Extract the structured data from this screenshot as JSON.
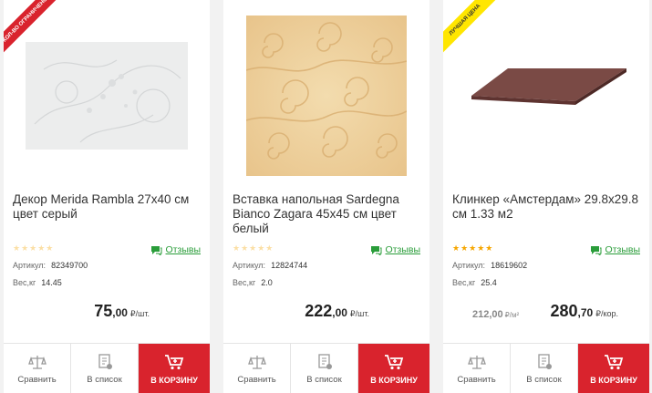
{
  "products": [
    {
      "ribbon": "КОЛ-ВО ОГРАНИЧЕНО",
      "title": "Декор Merida Rambla 27х40 см цвет серый",
      "rating_stars": "★★★★★",
      "rating": 0,
      "reviews_label": "Отзывы",
      "article_label": "Артикул:",
      "article": "82349700",
      "weight_label": "Вес,кг",
      "weight": "14.45",
      "price_int": "75",
      "price_frac": ",00",
      "price_unit": "₽/шт."
    },
    {
      "title": "Вставка напольная Sardegna Bianco Zagara 45х45 см цвет белый",
      "rating_stars": "★★★★★",
      "rating": 0,
      "reviews_label": "Отзывы",
      "article_label": "Артикул:",
      "article": "12824744",
      "weight_label": "Вес,кг",
      "weight": "2.0",
      "price_int": "222",
      "price_frac": ",00",
      "price_unit": "₽/шт."
    },
    {
      "ribbon": "ЛУЧШАЯ ЦЕНА",
      "title": "Клинкер «Амстердам» 29.8х29.8 см 1.33 м2",
      "rating_stars": "★★★★★",
      "rating": 4.5,
      "reviews_label": "Отзывы",
      "article_label": "Артикул:",
      "article": "18619602",
      "weight_label": "Вес,кг",
      "weight": "25.4",
      "old_price": "212,00",
      "old_unit": "₽/м²",
      "price_int": "280",
      "price_frac": ",70",
      "price_unit": "₽/кор."
    }
  ],
  "actions": {
    "compare": "Сравнить",
    "wishlist": "В список",
    "cart": "В КОРЗИНУ"
  },
  "colors": {
    "accent": "#d9232d",
    "reviews": "#2a9d3a",
    "star": "#f6a600",
    "best_price": "#ffe600"
  },
  "icons": [
    "scales-icon",
    "list-icon",
    "cart-icon",
    "chat-icon",
    "star-icon"
  ]
}
